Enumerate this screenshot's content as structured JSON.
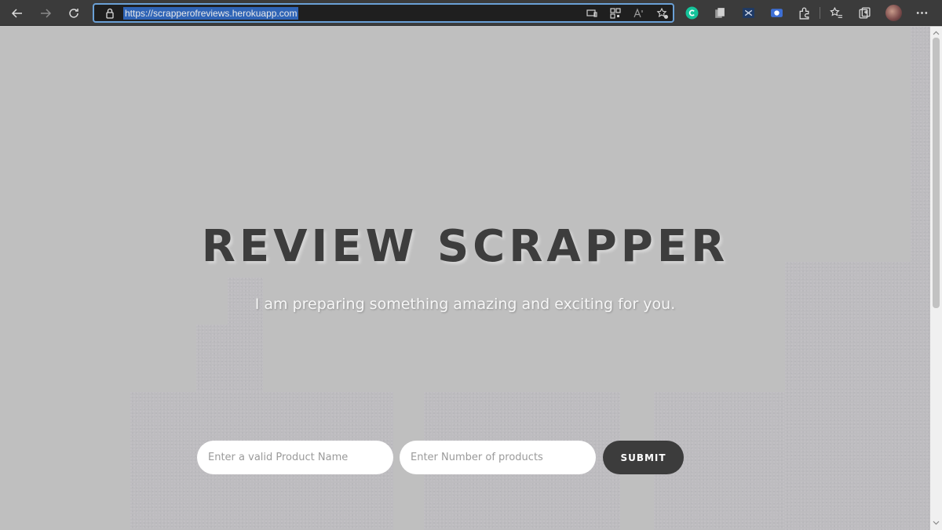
{
  "browser": {
    "url": "https://scrapperofreviews.herokuapp.com",
    "icons": {
      "back": "arrow-left-icon",
      "forward": "arrow-right-icon",
      "refresh": "refresh-icon",
      "lock": "lock-icon",
      "more": "more-icon"
    }
  },
  "page": {
    "title": "REVIEW SCRAPPER",
    "subtitle": "I am preparing something amazing and exciting for you.",
    "form": {
      "product_placeholder": "Enter a valid Product Name",
      "count_placeholder": "Enter Number of products",
      "submit_label": "SUBMIT"
    }
  },
  "colors": {
    "toolbar": "#3b3b3b",
    "address_focus": "#6aa0d6",
    "url_highlight": "#2f64b6",
    "page_bg": "#bfbfbf",
    "button_bg": "#3c3c3c"
  }
}
